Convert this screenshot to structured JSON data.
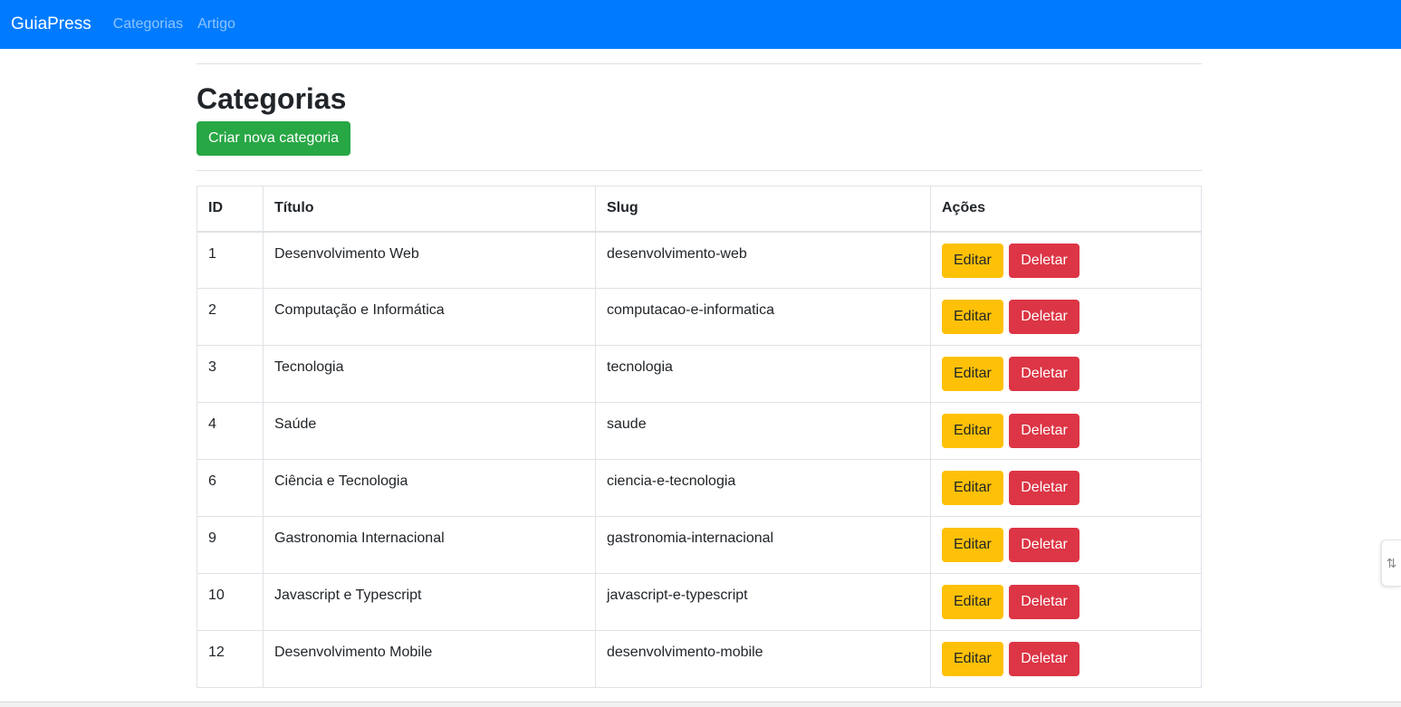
{
  "navbar": {
    "brand": "GuiaPress",
    "links": [
      "Categorias",
      "Artigo"
    ]
  },
  "page": {
    "title": "Categorias",
    "create_button": "Criar nova categoria"
  },
  "table": {
    "headers": [
      "ID",
      "Título",
      "Slug",
      "Ações"
    ],
    "rows": [
      {
        "id": "1",
        "title": "Desenvolvimento Web",
        "slug": "desenvolvimento-web"
      },
      {
        "id": "2",
        "title": "Computação e Informática",
        "slug": "computacao-e-informatica"
      },
      {
        "id": "3",
        "title": "Tecnologia",
        "slug": "tecnologia"
      },
      {
        "id": "4",
        "title": "Saúde",
        "slug": "saude"
      },
      {
        "id": "6",
        "title": "Ciência e Tecnologia",
        "slug": "ciencia-e-tecnologia"
      },
      {
        "id": "9",
        "title": "Gastronomia Internacional",
        "slug": "gastronomia-internacional"
      },
      {
        "id": "10",
        "title": "Javascript e Typescript",
        "slug": "javascript-e-typescript"
      },
      {
        "id": "12",
        "title": "Desenvolvimento Mobile",
        "slug": "desenvolvimento-mobile"
      }
    ],
    "edit_label": "Editar",
    "delete_label": "Deletar"
  },
  "side_widget": {
    "icon": "collapse-arrows-icon"
  },
  "colors": {
    "navbar": "#007bff",
    "success": "#28a745",
    "warning": "#ffc107",
    "danger": "#dc3545"
  }
}
